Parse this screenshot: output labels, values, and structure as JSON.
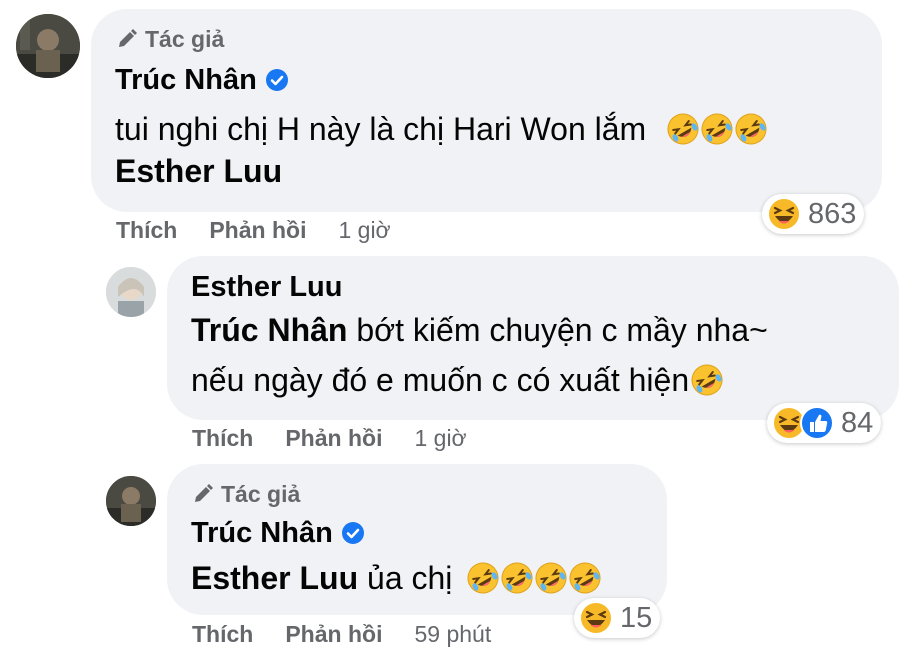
{
  "comments": [
    {
      "author_badge": "Tác giả",
      "name": "Trúc Nhân",
      "lines": [
        "tui nghi chị H này là chị Hari Won lắm"
      ],
      "mention": "Esther Luu",
      "reaction_count": "863",
      "like_label": "Thích",
      "reply_label": "Phản hồi",
      "time": "1 giờ"
    },
    {
      "name": "Esther Luu",
      "mention": "Trúc Nhân",
      "line1_rest": " bớt kiếm chuyện c mầy nha~",
      "line2": "nếu ngày đó e muốn c có xuất hiện",
      "reaction_count": "84",
      "like_label": "Thích",
      "reply_label": "Phản hồi",
      "time": "1 giờ"
    },
    {
      "author_badge": "Tác giả",
      "name": "Trúc Nhân",
      "mention": "Esther Luu",
      "line_rest": " ủa chị",
      "reaction_count": "15",
      "like_label": "Thích",
      "reply_label": "Phản hồi",
      "time": "59 phút"
    }
  ],
  "icons": {
    "author": "pencil-icon",
    "verified": "verified-badge-icon",
    "emoji": "rolling-on-floor-laughing-emoji",
    "haha": "haha-reaction-icon",
    "like": "like-reaction-icon"
  },
  "colors": {
    "bubble": "#f0f2f5",
    "secondary_text": "#65676b",
    "verified": "#1877f2"
  }
}
